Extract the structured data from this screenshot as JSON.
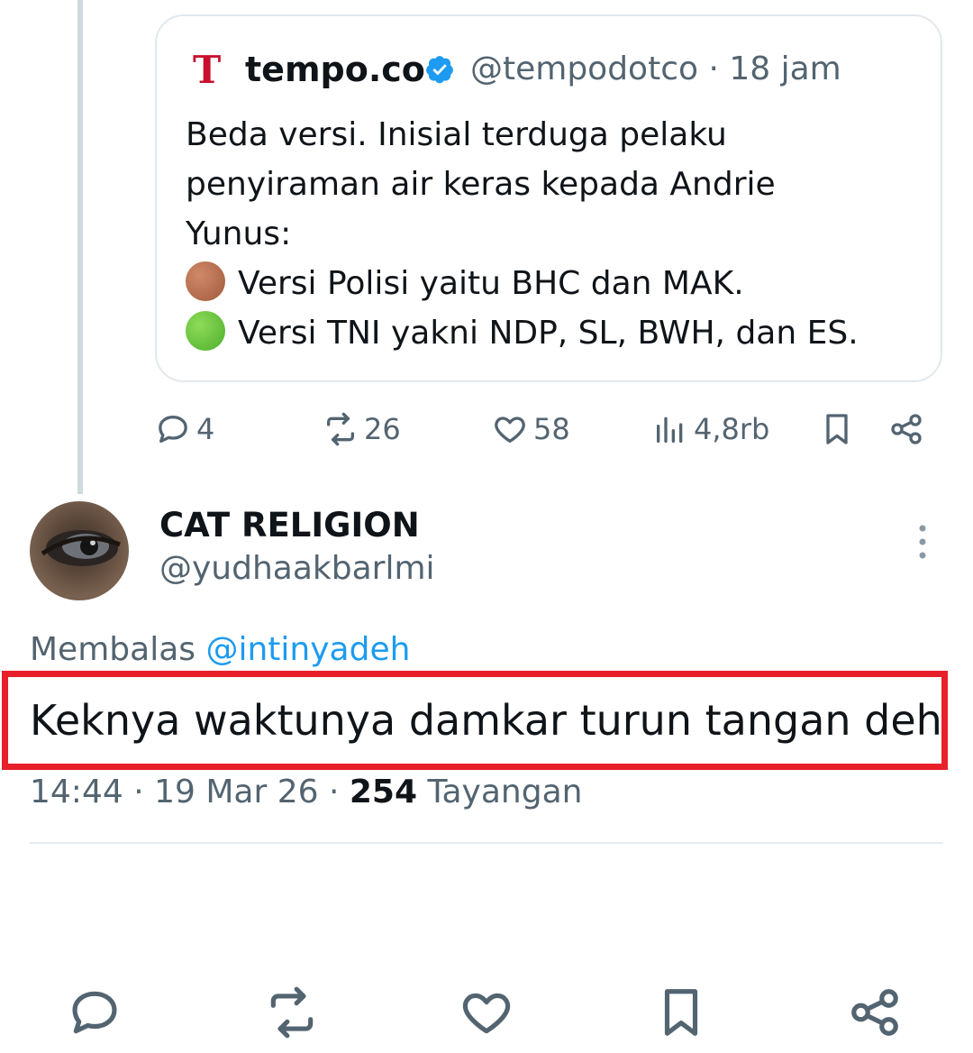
{
  "quoted_tweet": {
    "logo_letter": "T",
    "name": "tempo.co",
    "handle_time": "@tempodotco · 18 jam",
    "text_lines": [
      "Beda versi. Inisial terduga pelaku",
      "penyiraman air keras kepada Andrie",
      "Yunus:"
    ],
    "bullets": [
      "Versi Polisi yaitu BHC dan MAK.",
      "Versi TNI yakni NDP, SL, BWH, dan ES."
    ],
    "replies": "4",
    "reposts": "26",
    "likes": "58",
    "views": "4,8rb"
  },
  "tweet": {
    "display_name": "CAT RELIGION",
    "username": "@yudhaakbarlmi",
    "replying_prefix": "Membalas",
    "replying_to": "@intinyadeh",
    "text": "Keknya waktunya damkar turun tangan deh",
    "time": "14:44 · 19 Mar 26 ·",
    "views_count": "254",
    "views_label": "Tayangan"
  },
  "colors": {
    "accent": "#1d9bf0",
    "highlight": "#e8202a",
    "muted": "#536471"
  },
  "icons": [
    "reply-icon",
    "repost-icon",
    "like-icon",
    "views-icon",
    "bookmark-icon",
    "share-icon",
    "verified-icon",
    "more-icon"
  ]
}
